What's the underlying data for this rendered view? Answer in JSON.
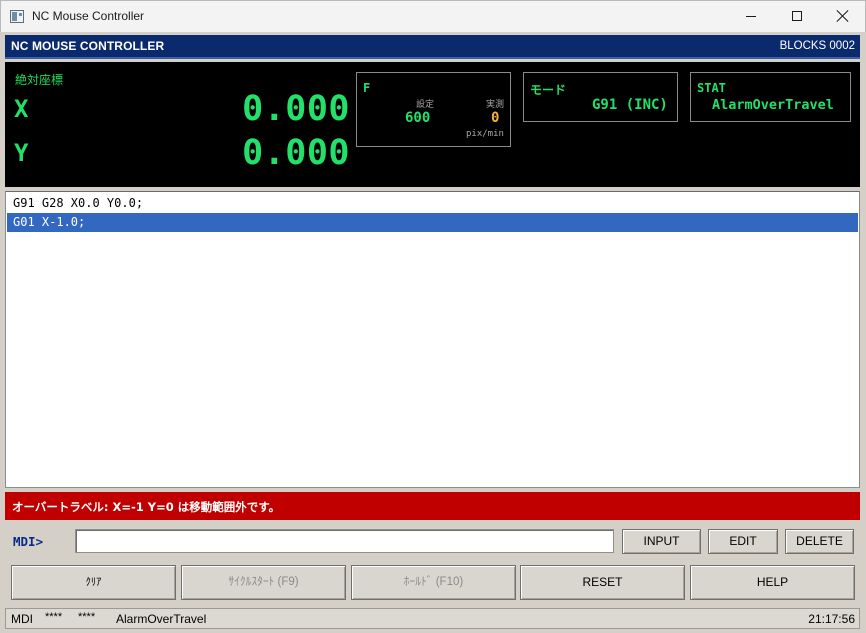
{
  "window": {
    "title": "NC Mouse Controller",
    "minimize_icon": "minimize-icon",
    "maximize_icon": "maximize-icon",
    "close_icon": "close-icon"
  },
  "header": {
    "title": "NC MOUSE CONTROLLER",
    "blocks": "BLOCKS 0002"
  },
  "dro": {
    "coord_label": "絶対座標",
    "x_label": "X",
    "x_value": "0.000",
    "y_label": "Y",
    "y_value": "0.000",
    "feed": {
      "title": "F",
      "set_label": "設定",
      "actual_label": "実測",
      "set_value": "600",
      "actual_value": "0",
      "unit": "pix/min"
    },
    "mode": {
      "title": "モード",
      "value": "G91 (INC)"
    },
    "stat": {
      "title": "STAT",
      "value": "AlarmOverTravel"
    }
  },
  "program": {
    "lines": [
      "G91 G28 X0.0 Y0.0;",
      "G01 X-1.0;"
    ],
    "selected_index": 1
  },
  "alarm": {
    "message": "オーバートラベル: X=-1 Y=0 は移動範囲外です。"
  },
  "mdi": {
    "label": "MDI>",
    "value": "",
    "input_button": "INPUT",
    "edit_button": "EDIT",
    "delete_button": "DELETE"
  },
  "actions": {
    "clear": "ｸﾘｱ",
    "cycle_start": "ｻｲｸﾙｽﾀｰﾄ (F9)",
    "hold": "ﾎｰﾙﾄﾞ (F10)",
    "reset": "RESET",
    "help": "HELP"
  },
  "statusbar": {
    "mode": "MDI",
    "slot1": "****",
    "slot2": "****",
    "status": "AlarmOverTravel",
    "time": "21:17:56"
  },
  "colors": {
    "header_bg": "#0a2a6d",
    "dro_green": "#22e06a",
    "actual_orange": "#f3b13a",
    "alarm_red": "#c00000",
    "selection_blue": "#3368c0"
  }
}
